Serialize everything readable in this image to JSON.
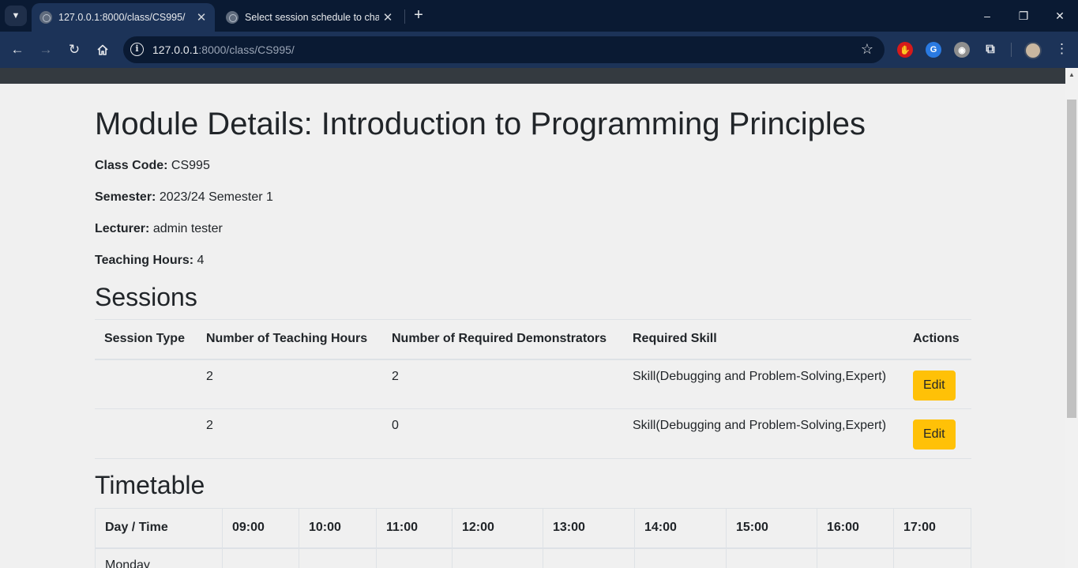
{
  "browser": {
    "tabs": [
      {
        "title": "127.0.0.1:8000/class/CS995/",
        "active": true
      },
      {
        "title": "Select session schedule to change",
        "active": false
      }
    ],
    "url_host": "127.0.0.1",
    "url_rest": ":8000/class/CS995/",
    "icons": {
      "back": "back-arrow-icon",
      "forward": "forward-arrow-icon",
      "reload": "reload-icon",
      "home": "home-icon",
      "info": "site-info-icon",
      "bookmark": "bookmark-star-icon",
      "extensions": "puzzle-icon",
      "menu": "kebab-menu-icon"
    },
    "window_controls": {
      "minimize": "–",
      "restore": "❐",
      "close": "✕"
    }
  },
  "page": {
    "title": "Module Details: Introduction to Programming Principles",
    "details": [
      {
        "label": "Class Code:",
        "value": "CS995"
      },
      {
        "label": "Semester:",
        "value": "2023/24 Semester 1"
      },
      {
        "label": "Lecturer:",
        "value": "admin tester"
      },
      {
        "label": "Teaching Hours:",
        "value": "4"
      }
    ],
    "sessions_heading": "Sessions",
    "sessions_table": {
      "headers": [
        "Session Type",
        "Number of Teaching Hours",
        "Number of Required Demonstrators",
        "Required Skill",
        "Actions"
      ],
      "rows": [
        {
          "session_type": "",
          "hours": "2",
          "demonstrators": "2",
          "skill": "Skill(Debugging and Problem-Solving,Expert)",
          "action_label": "Edit"
        },
        {
          "session_type": "",
          "hours": "2",
          "demonstrators": "0",
          "skill": "Skill(Debugging and Problem-Solving,Expert)",
          "action_label": "Edit"
        }
      ]
    },
    "timetable_heading": "Timetable",
    "timetable": {
      "headers": [
        "Day / Time",
        "09:00",
        "10:00",
        "11:00",
        "12:00",
        "13:00",
        "14:00",
        "15:00",
        "16:00",
        "17:00"
      ],
      "first_day": "Monday"
    }
  },
  "colors": {
    "edit_button": "#ffc107",
    "page_navbar": "#343a40",
    "browser_tabbar": "#0a1a33",
    "browser_toolbar": "#1c3358"
  }
}
